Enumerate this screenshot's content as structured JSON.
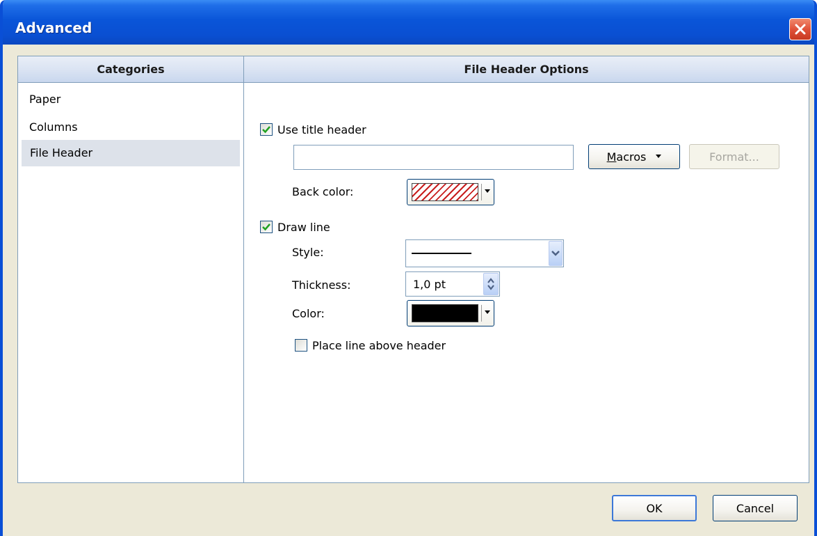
{
  "window": {
    "title": "Advanced"
  },
  "categories": {
    "header": "Categories",
    "items": [
      "Paper",
      "Columns",
      "File Header"
    ],
    "selected": "File Header"
  },
  "options": {
    "header": "File Header Options",
    "use_title_header": {
      "label": "Use title header",
      "checked": true
    },
    "title_text": {
      "value": ""
    },
    "macros_button": {
      "label_prefix": "M",
      "label_rest": "acros"
    },
    "format_button": {
      "label": "Format...",
      "enabled": false
    },
    "back_color": {
      "label": "Back color:",
      "swatch": "hatched-red"
    },
    "draw_line": {
      "label": "Draw line",
      "checked": true
    },
    "style": {
      "label": "Style:",
      "value": "solid-line"
    },
    "thickness": {
      "label": "Thickness:",
      "value": "1,0 pt"
    },
    "color": {
      "label": "Color:",
      "value": "#000000"
    },
    "place_line_above": {
      "label": "Place line above header",
      "checked": false
    }
  },
  "footer": {
    "ok_label": "OK",
    "cancel_label": "Cancel"
  },
  "colors": {
    "title_bar": "#0a55d8",
    "panel_header": "#dbe4f3",
    "selected_item": "#dde2ea",
    "dialog_bg": "#ece9d8"
  }
}
